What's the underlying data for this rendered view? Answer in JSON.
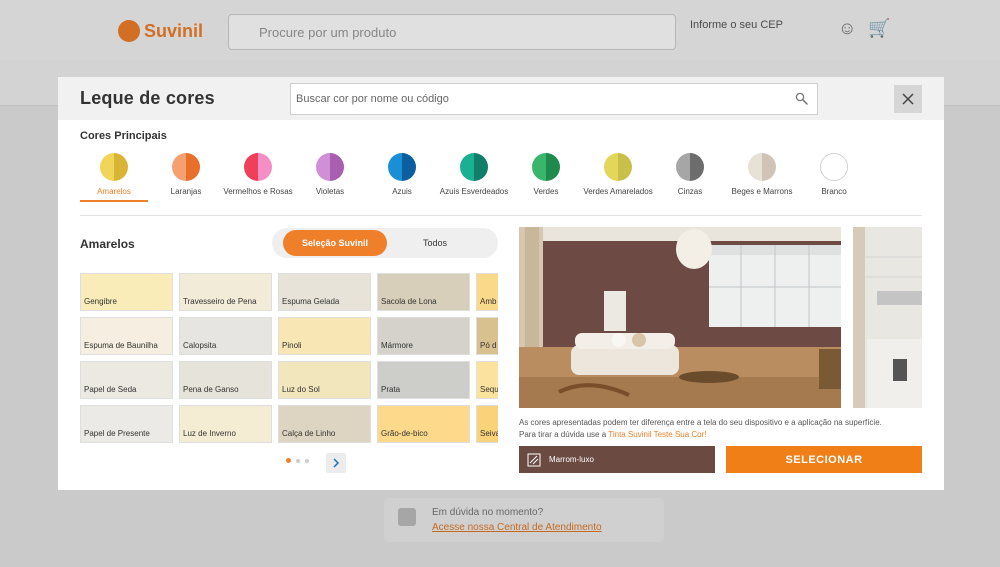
{
  "background": {
    "logo": "Suvinil",
    "search_placeholder": "Procure por um produto",
    "location_line1": "Informe o seu CEP",
    "location_line2": "",
    "help_title": "Em dúvida no momento?",
    "help_link": "Acesse nossa Central de Atendimento"
  },
  "modal": {
    "title": "Leque de cores",
    "search_placeholder": "Buscar cor por nome ou código",
    "close_icon": "close-icon",
    "section_label": "Cores Principais",
    "categories": [
      {
        "label": "Amarelos",
        "colors": [
          "#f1d55a",
          "#d9b536"
        ],
        "active": true
      },
      {
        "label": "Laranjas",
        "colors": [
          "#f4a071",
          "#e8702a"
        ]
      },
      {
        "label": "Vermelhos e Rosas",
        "colors": [
          "#ef3f5a",
          "#f58ec4"
        ]
      },
      {
        "label": "Violetas",
        "colors": [
          "#d08fd6",
          "#a85fb0"
        ]
      },
      {
        "label": "Azuis",
        "colors": [
          "#1b8fd6",
          "#0b5f9e"
        ]
      },
      {
        "label": "Azuis Esverdeados",
        "colors": [
          "#1bb094",
          "#107e6b"
        ]
      },
      {
        "label": "Verdes",
        "colors": [
          "#3ab56c",
          "#1e8a4d"
        ]
      },
      {
        "label": "Verdes Amarelados",
        "colors": [
          "#e4d65a",
          "#c9c04a"
        ]
      },
      {
        "label": "Cinzas",
        "colors": [
          "#a6a6a6",
          "#6d6d6d"
        ]
      },
      {
        "label": "Beges e Marrons",
        "colors": [
          "#e8e1d6",
          "#cfc4b5"
        ]
      },
      {
        "label": "Branco",
        "colors": [
          "#ffffff",
          "#ffffff"
        ]
      }
    ],
    "subtitle": "Amarelos",
    "toggle": {
      "on": "Seleção Suvinil",
      "off": "Todos"
    },
    "tiles": [
      [
        {
          "name": "Gengibre",
          "color": "#f9ecb9"
        },
        {
          "name": "Travesseiro de Pena",
          "color": "#f1ebd8"
        },
        {
          "name": "Espuma Gelada",
          "color": "#e7e3d9"
        },
        {
          "name": "Sacola de Lona",
          "color": "#d8cfba"
        },
        {
          "name": "Amb",
          "color": "#fbd98a"
        }
      ],
      [
        {
          "name": "Espuma de Baunilha",
          "color": "#f6efe1"
        },
        {
          "name": "Calopsita",
          "color": "#e6e5e1"
        },
        {
          "name": "Pinoli",
          "color": "#f8e6b4"
        },
        {
          "name": "Mármore",
          "color": "#d4d2cb"
        },
        {
          "name": "Pó d",
          "color": "#d8c08f"
        }
      ],
      [
        {
          "name": "Papel de Seda",
          "color": "#ece9e2"
        },
        {
          "name": "Pena de Ganso",
          "color": "#e6e3da"
        },
        {
          "name": "Luz do Sol",
          "color": "#f2e6bc"
        },
        {
          "name": "Prata",
          "color": "#cdcdca"
        },
        {
          "name": "Sequ",
          "color": "#fbe39e"
        }
      ],
      [
        {
          "name": "Papel de Presente",
          "color": "#ebeae6"
        },
        {
          "name": "Luz de Inverno",
          "color": "#f4edd3"
        },
        {
          "name": "Calça de Linho",
          "color": "#ddd5c1"
        },
        {
          "name": "Grão-de-bico",
          "color": "#fcd98b"
        },
        {
          "name": "Seiva",
          "color": "#f9d27a"
        }
      ]
    ],
    "pagination": {
      "pages": 3,
      "current": 1
    },
    "next_icon": "chevron-right-icon",
    "disclaimer_line1": "As cores apresentadas podem ter diferença entre a tela do seu dispositivo e a aplicação na superfície.",
    "disclaimer_line2_prefix": "Para tirar a dúvida use a ",
    "disclaimer_link": "Tinta Suvinil Teste Sua Cor!",
    "selected_color_name": "Marrom-luxo",
    "selected_color_hex": "#6b4a42",
    "select_button": "SELECIONAR"
  }
}
